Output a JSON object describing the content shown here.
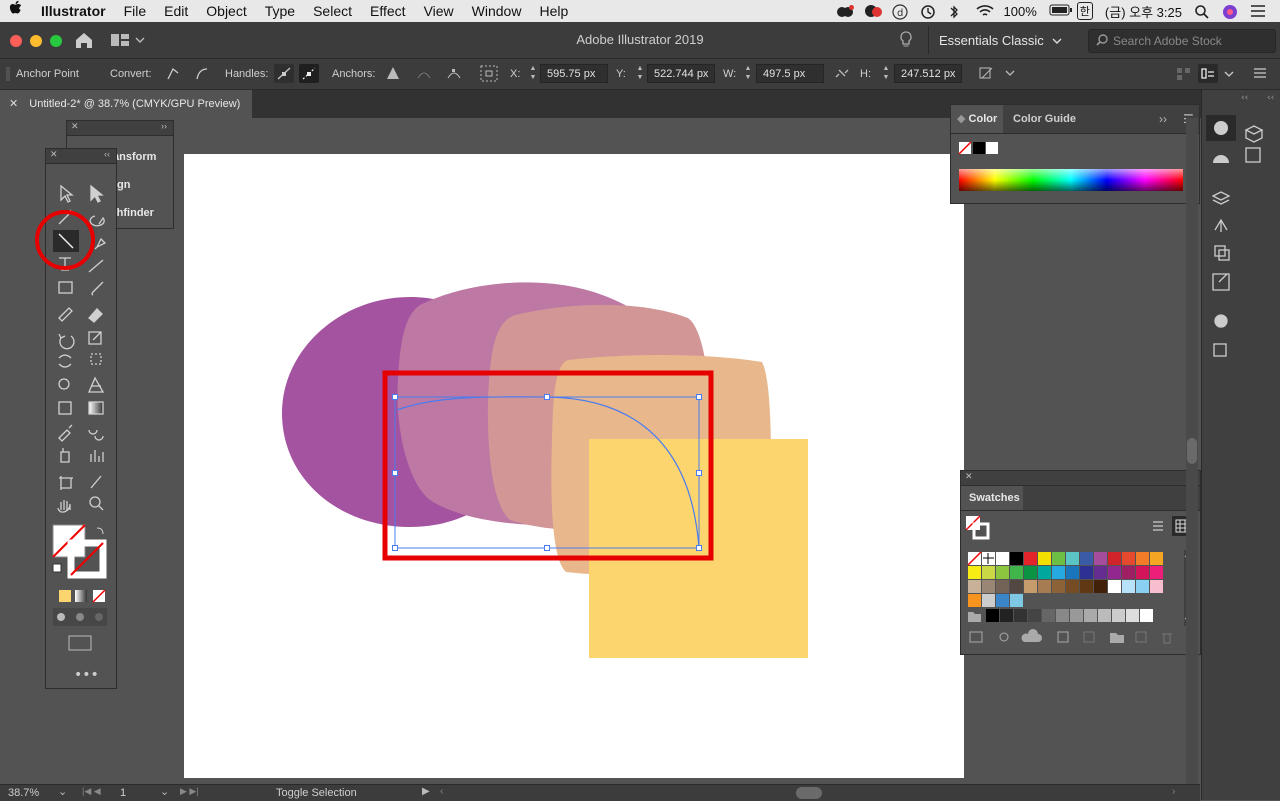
{
  "menubar": {
    "app_name": "Illustrator",
    "items": [
      "File",
      "Edit",
      "Object",
      "Type",
      "Select",
      "Effect",
      "View",
      "Window",
      "Help"
    ],
    "battery": "100%",
    "input_method": "한",
    "clock": "(금) 오후 3:25"
  },
  "titlebar": {
    "title": "Adobe Illustrator 2019",
    "workspace": "Essentials Classic",
    "search_placeholder": "Search Adobe Stock"
  },
  "control_bar": {
    "tool_name": "Anchor Point",
    "convert_label": "Convert:",
    "handles_label": "Handles:",
    "anchors_label": "Anchors:",
    "x_label": "X:",
    "x_value": "595.75 px",
    "y_label": "Y:",
    "y_value": "522.744 px",
    "w_label": "W:",
    "w_value": "497.5 px",
    "h_label": "H:",
    "h_value": "247.512 px"
  },
  "document": {
    "tab_title": "Untitled-2* @ 38.7% (CMYK/GPU Preview)"
  },
  "floating_panel": {
    "items": [
      "ansform",
      "gn",
      "thfinder"
    ]
  },
  "color_panel": {
    "tabs": [
      "Color",
      "Color Guide"
    ]
  },
  "swatches_panel": {
    "title": "Swatches"
  },
  "statusbar": {
    "zoom": "38.7%",
    "artboard_num": "1",
    "status_text": "Toggle Selection"
  },
  "colors": {
    "accent_red": "#e60000",
    "purple": "#a453a0",
    "mauve": "#bd78a3",
    "rose": "#d39697",
    "peach": "#e8b88c",
    "yellow": "#fdd56e",
    "selection_blue": "#4a7cf0"
  }
}
